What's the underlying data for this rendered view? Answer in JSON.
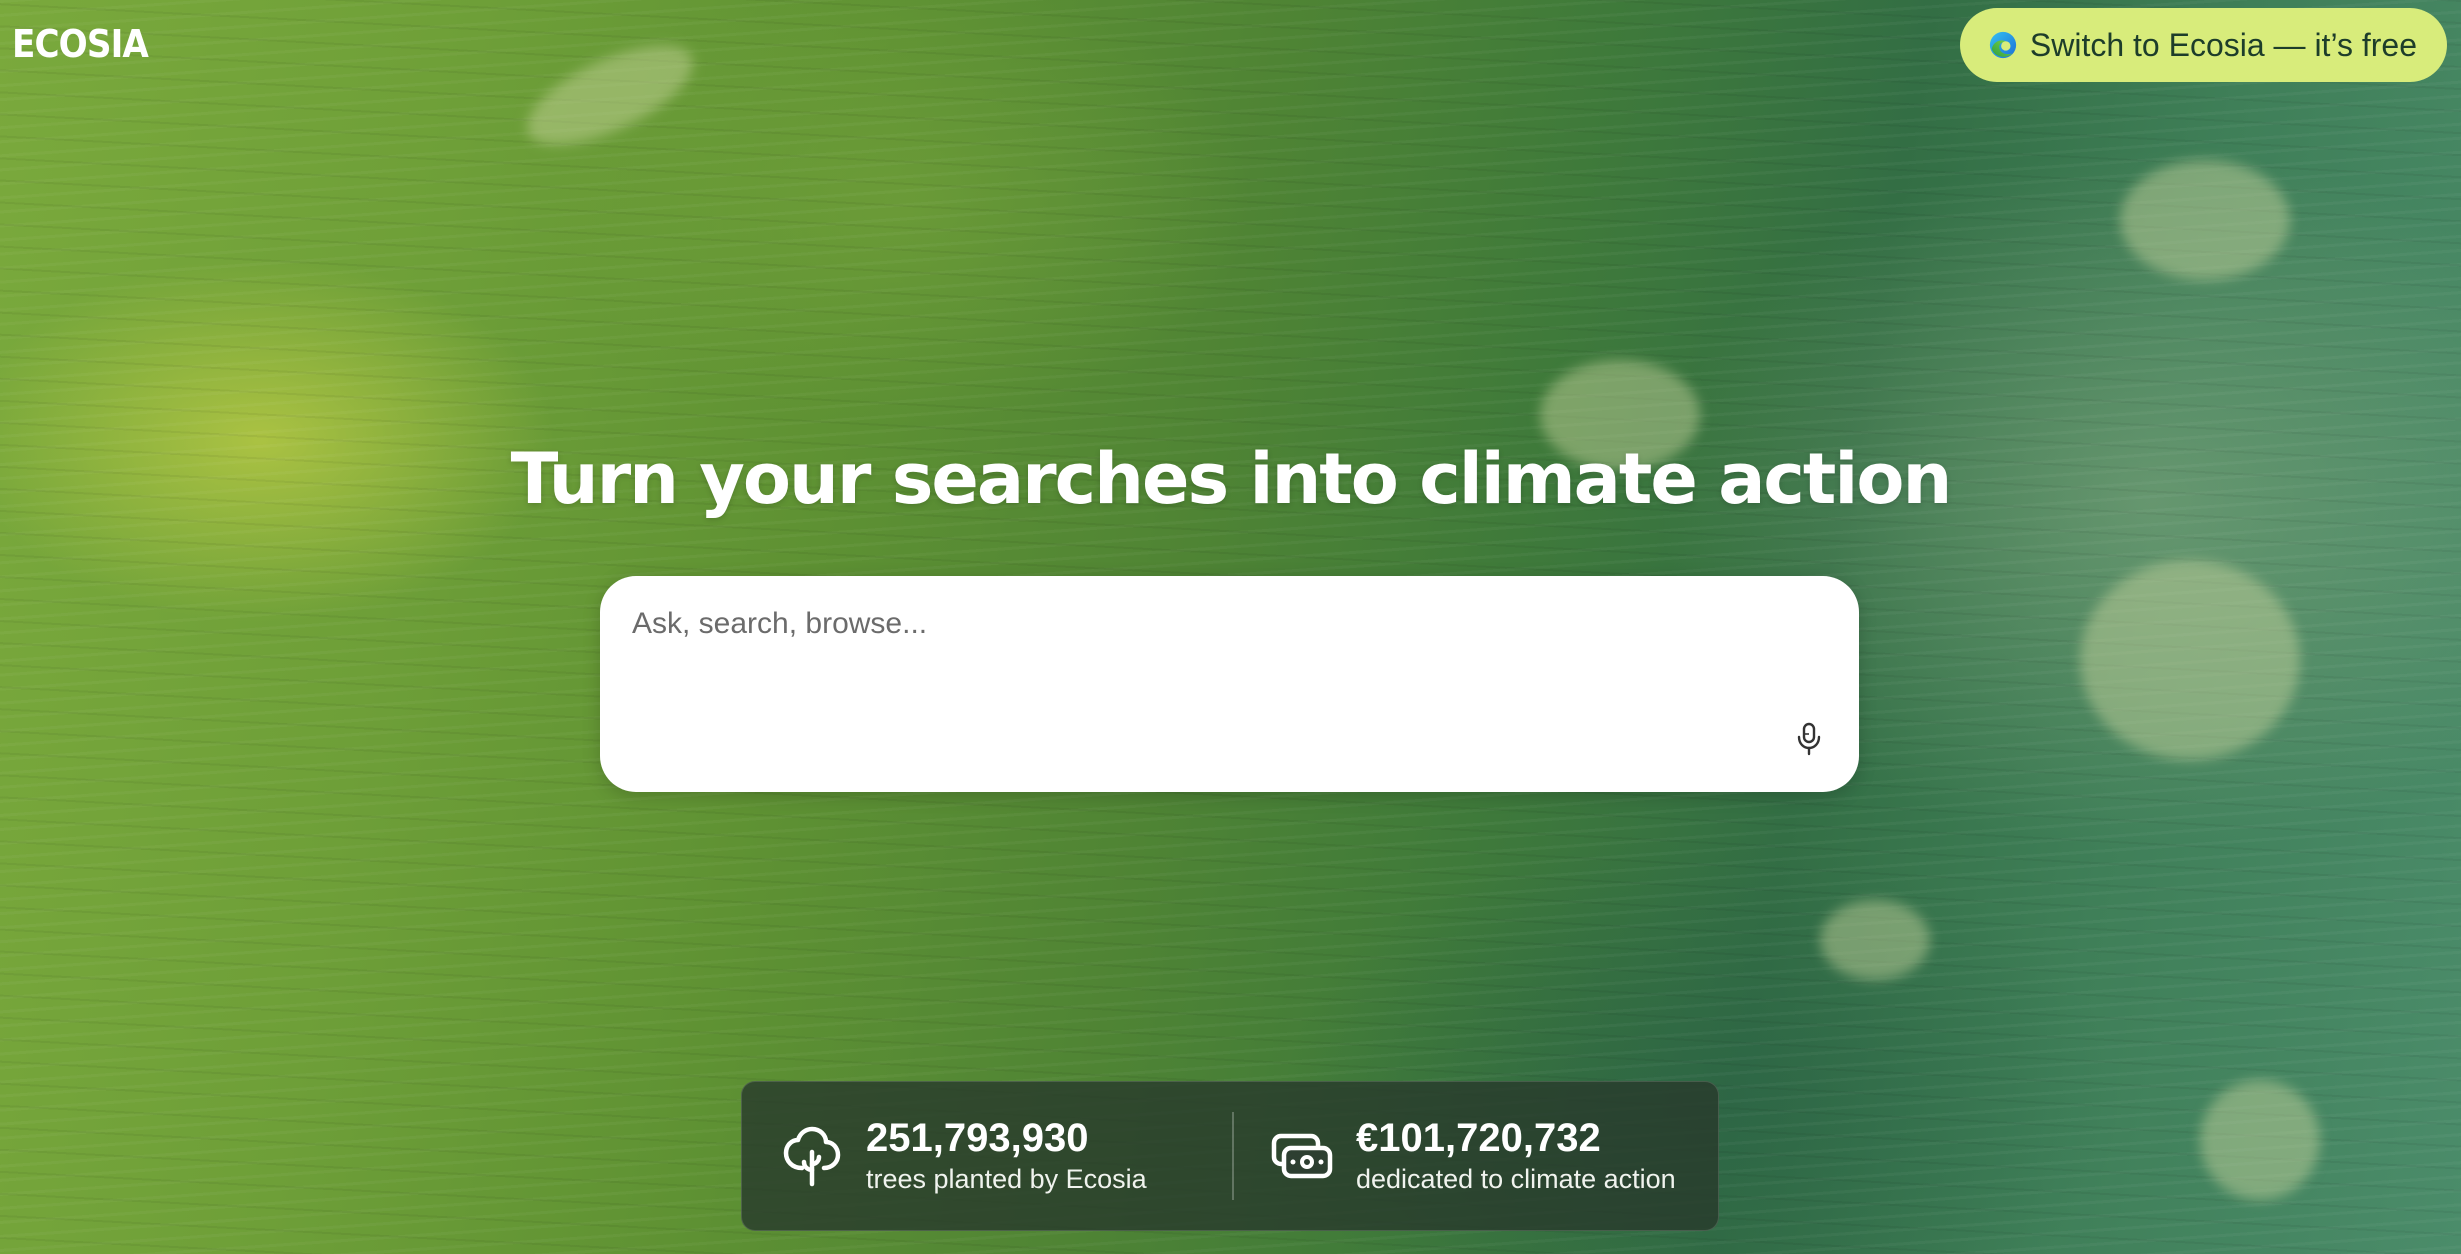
{
  "brand": {
    "logo_text": "ECOSIA"
  },
  "header": {
    "cta_label": "Switch to Ecosia — it’s free",
    "cta_icon": "edge-browser-icon"
  },
  "hero": {
    "headline": "Turn your searches into climate action"
  },
  "search": {
    "placeholder": "Ask, search, browse...",
    "value": "",
    "mic_icon": "microphone-icon"
  },
  "stats": [
    {
      "icon": "tree-icon",
      "value": "251,793,930",
      "label": "trees planted by Ecosia"
    },
    {
      "icon": "money-icon",
      "value": "€101,720,732",
      "label": "dedicated to climate action"
    }
  ],
  "colors": {
    "cta_background": "#d8ec7b",
    "cta_text": "#1d3d2a",
    "stats_background": "#283a2c",
    "background_green": "#5f9233"
  }
}
